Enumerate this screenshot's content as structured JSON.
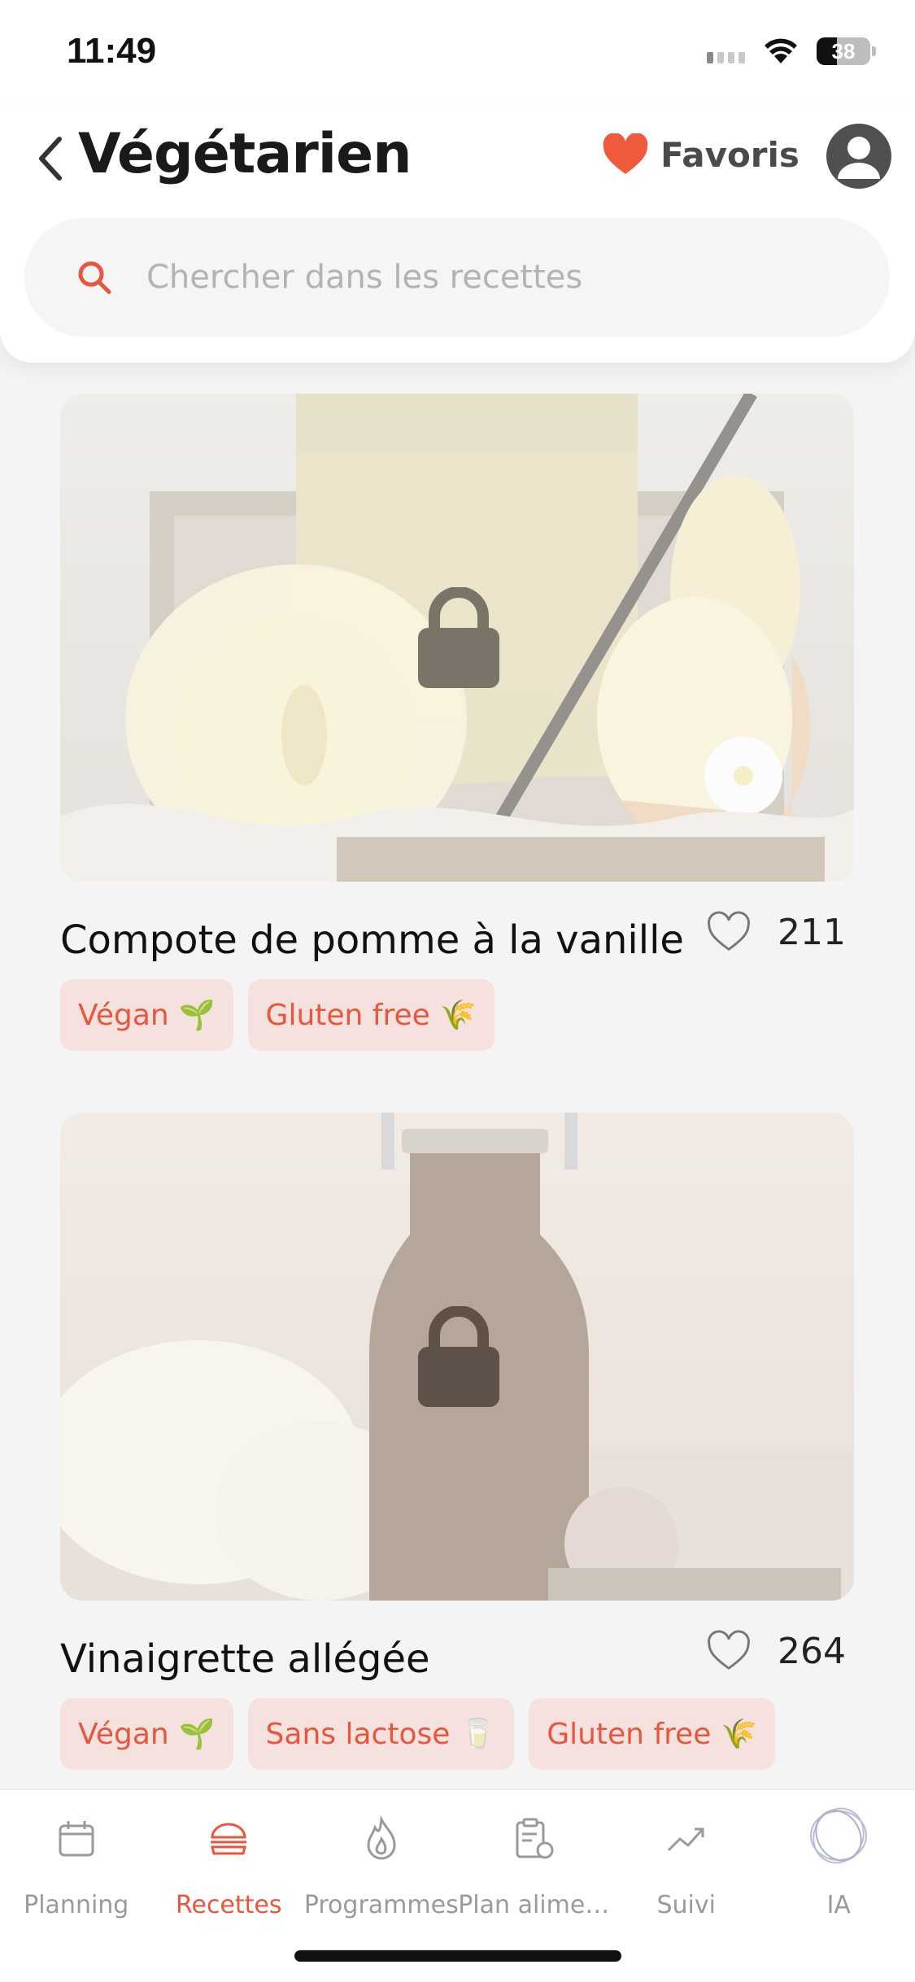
{
  "status": {
    "time": "11:49",
    "battery": "38",
    "battery_level": 0.38
  },
  "header": {
    "title": "Végétarien",
    "favorites_label": "Favoris",
    "search": {
      "placeholder": "Chercher dans les recettes"
    }
  },
  "recipes": [
    {
      "title": "Compote de pomme à la vanille",
      "likes": "211",
      "locked": true,
      "image": "apple-compote-jar",
      "tags": [
        {
          "label": "Végan",
          "emoji": "🌱"
        },
        {
          "label": "Gluten free",
          "emoji": "🌾"
        }
      ]
    },
    {
      "title": "Vinaigrette allégée",
      "likes": "264",
      "locked": true,
      "image": "vinaigrette-bottle",
      "tags": [
        {
          "label": "Végan",
          "emoji": "🌱"
        },
        {
          "label": "Sans lactose",
          "emoji": "🥛"
        },
        {
          "label": "Gluten free",
          "emoji": "🌾"
        }
      ]
    }
  ],
  "nav": {
    "active": "Recettes",
    "items": [
      {
        "label": "Planning",
        "icon": "calendar-icon"
      },
      {
        "label": "Recettes",
        "icon": "burger-icon"
      },
      {
        "label": "Programmes",
        "icon": "flame-icon"
      },
      {
        "label": "Plan alime…",
        "icon": "clipboard-apple-icon"
      },
      {
        "label": "Suivi",
        "icon": "trend-icon"
      },
      {
        "label": "IA",
        "icon": "ai-orb-icon"
      }
    ]
  },
  "colors": {
    "accent": "#e8563d",
    "tag_bg": "#f5e1de",
    "heart": "#f05a3c"
  }
}
